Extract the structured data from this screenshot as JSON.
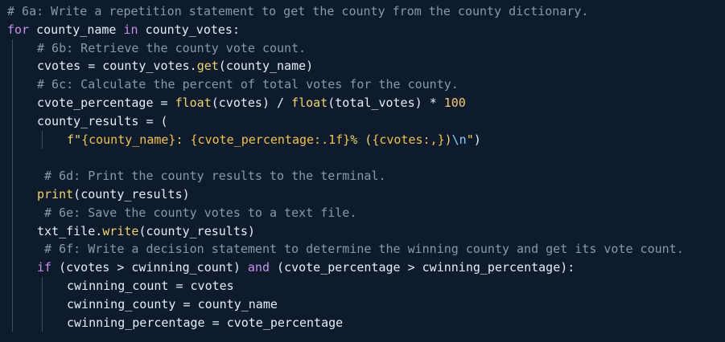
{
  "code_lines": [
    {
      "indent": 0,
      "kind": "comment",
      "text": "# 6a: Write a repetition statement to get the county from the county dictionary."
    },
    {
      "indent": 0,
      "kind": "code",
      "text": "for county_name in county_votes:"
    },
    {
      "indent": 1,
      "kind": "comment",
      "text": "# 6b: Retrieve the county vote count."
    },
    {
      "indent": 1,
      "kind": "code",
      "text": "cvotes = county_votes.get(county_name)"
    },
    {
      "indent": 1,
      "kind": "comment",
      "text": "# 6c: Calculate the percent of total votes for the county."
    },
    {
      "indent": 1,
      "kind": "code",
      "text": "cvote_percentage = float(cvotes) / float(total_votes) * 100"
    },
    {
      "indent": 1,
      "kind": "code",
      "text": "county_results = ("
    },
    {
      "indent": 2,
      "kind": "code",
      "text": "f\"{county_name}: {cvote_percentage:.1f}% ({cvotes:,})\\n\")"
    },
    {
      "indent": 1,
      "kind": "blank",
      "text": ""
    },
    {
      "indent": 1,
      "kind": "comment",
      "text": " # 6d: Print the county results to the terminal."
    },
    {
      "indent": 1,
      "kind": "code",
      "text": "print(county_results)"
    },
    {
      "indent": 1,
      "kind": "comment",
      "text": " # 6e: Save the county votes to a text file."
    },
    {
      "indent": 1,
      "kind": "code",
      "text": "txt_file.write(county_results)"
    },
    {
      "indent": 1,
      "kind": "comment",
      "text": " # 6f: Write a decision statement to determine the winning county and get its vote count."
    },
    {
      "indent": 1,
      "kind": "code",
      "text": "if (cvotes > cwinning_count) and (cvote_percentage > cwinning_percentage):"
    },
    {
      "indent": 2,
      "kind": "code",
      "text": "cwinning_count = cvotes"
    },
    {
      "indent": 2,
      "kind": "code",
      "text": "cwinning_county = county_name"
    },
    {
      "indent": 2,
      "kind": "code",
      "text": "cwinning_percentage = cvote_percentage"
    }
  ],
  "colors": {
    "background": "#0d1b2d",
    "comment": "#8a98aa",
    "keyword": "#c792ea",
    "identifier": "#e8edf5",
    "function": "#f2d36b",
    "number": "#f8c875",
    "escape": "#7fd3ff",
    "indent_guide": "#3d4f66"
  }
}
